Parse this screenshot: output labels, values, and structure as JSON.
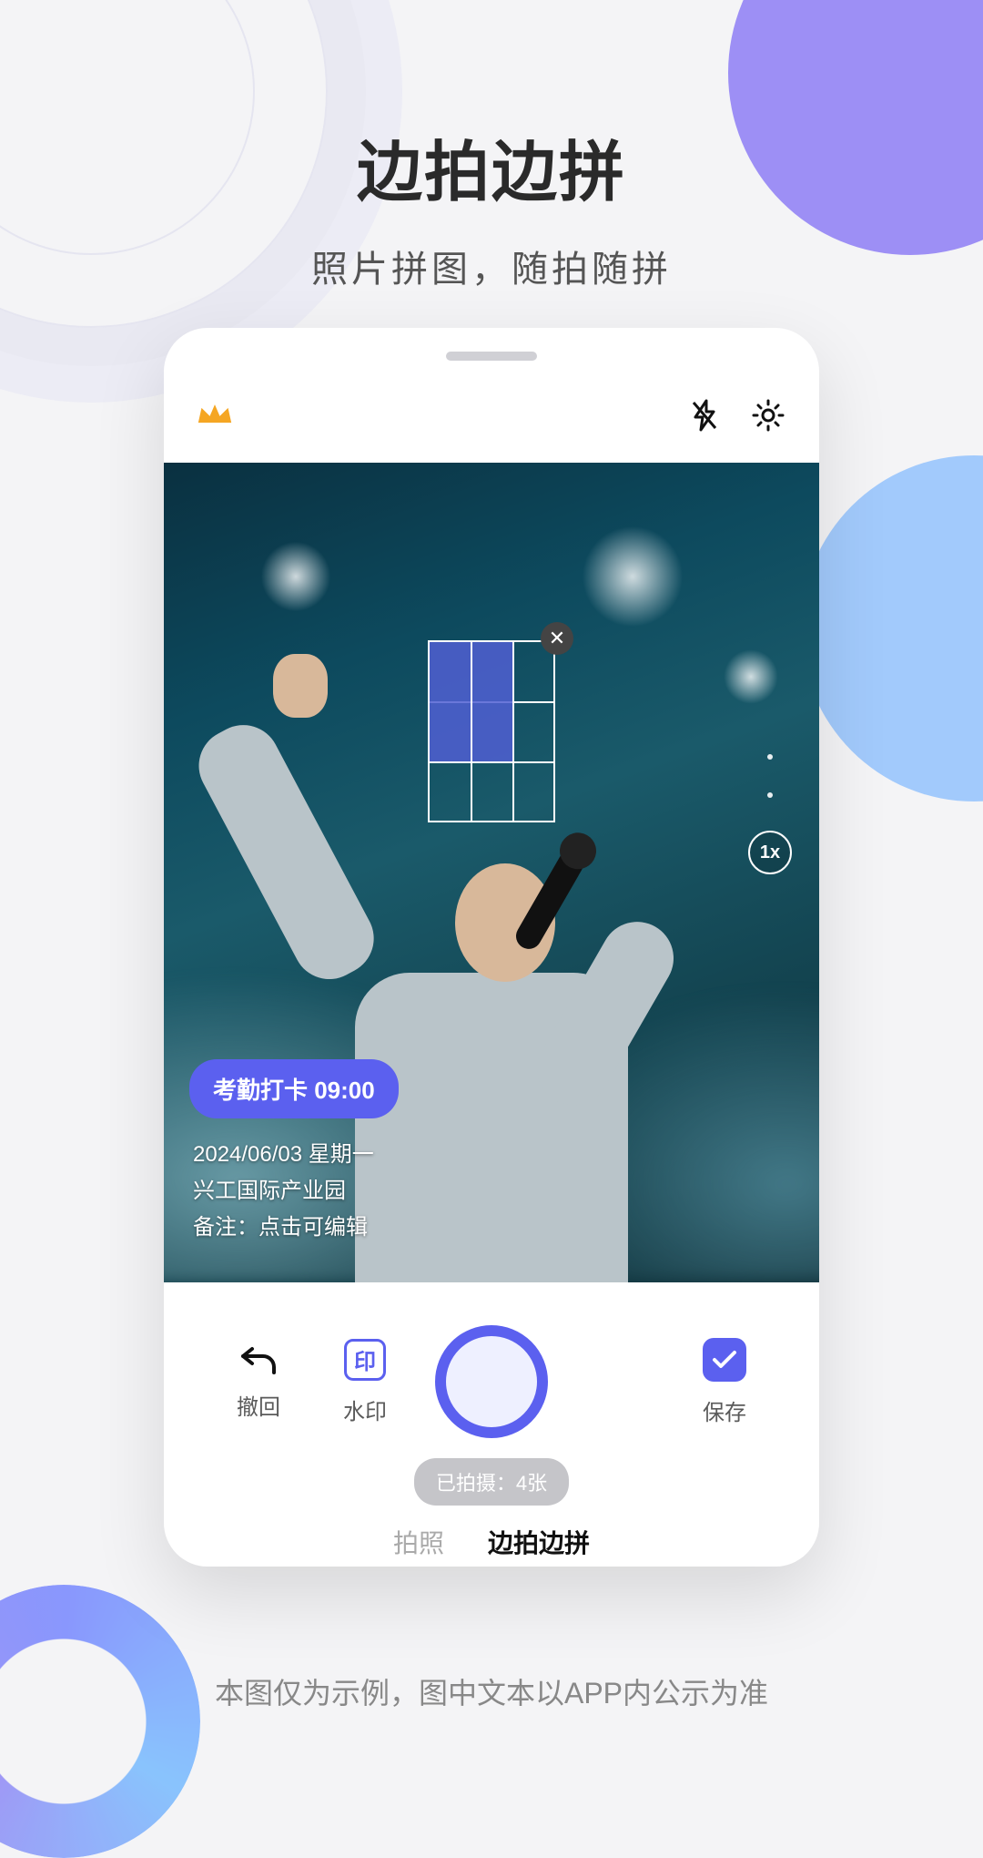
{
  "page": {
    "headline": "边拍边拼",
    "subheadline": "照片拼图，随拍随拼",
    "disclaimer": "本图仅为示例，图中文本以APP内公示为准"
  },
  "header": {
    "crown_icon": "crown-icon",
    "flash_icon": "flash-off-icon",
    "settings_icon": "gear-icon"
  },
  "viewfinder": {
    "zoom_label": "1x",
    "grid": {
      "rows": 3,
      "cols": 3,
      "filled_cells": 4
    },
    "watermark": {
      "pill": "考勤打卡 09:00",
      "line1": "2024/06/03 星期一",
      "line2": "兴工国际产业园",
      "line3": "备注：点击可编辑"
    }
  },
  "controls": {
    "undo_label": "撤回",
    "watermark_label": "水印",
    "watermark_glyph": "印",
    "save_label": "保存",
    "count_chip": "已拍摄：4张",
    "mode_tabs": {
      "photo": "拍照",
      "collage": "边拍边拼"
    }
  }
}
